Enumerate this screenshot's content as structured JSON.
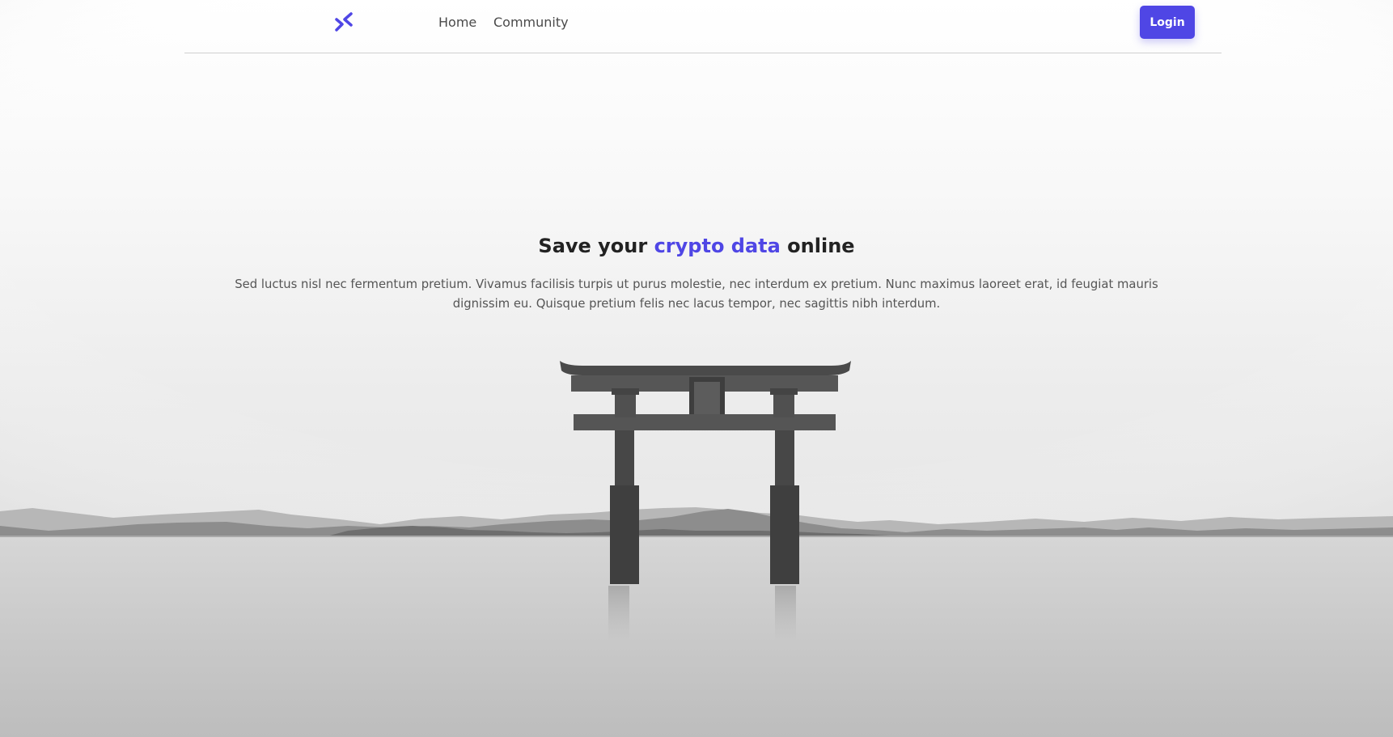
{
  "nav": {
    "logo_icon": "chevrons-collapse-icon",
    "links": [
      {
        "label": "Home"
      },
      {
        "label": "Community"
      }
    ],
    "login_label": "Login"
  },
  "hero": {
    "title_before": "Save your ",
    "title_accent": "crypto data",
    "title_after": " online",
    "description": "Sed luctus nisl nec fermentum pretium. Vivamus facilisis turpis ut purus molestie, nec interdum ex pretium. Nunc maximus laoreet erat, id feugiat mauris dignissim eu. Quisque pretium felis nec lacus tempor, nec sagittis nibh interdum."
  },
  "colors": {
    "accent": "#4f46e5",
    "text_dark": "#222222",
    "text_muted": "#555555",
    "divider": "#cfcfcf"
  }
}
